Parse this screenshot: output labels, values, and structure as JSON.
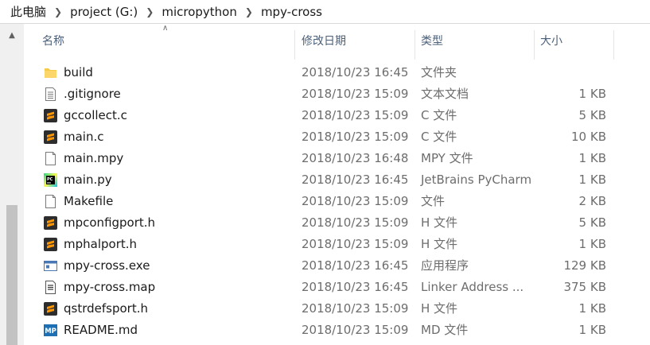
{
  "breadcrumb": [
    "此电脑",
    "project (G:)",
    "micropython",
    "mpy-cross"
  ],
  "columns": {
    "name": "名称",
    "date": "修改日期",
    "type": "类型",
    "size": "大小"
  },
  "files": [
    {
      "name": "build",
      "date": "2018/10/23 16:45",
      "type": "文件夹",
      "size": "",
      "icon": "folder-icon"
    },
    {
      "name": ".gitignore",
      "date": "2018/10/23 15:09",
      "type": "文本文档",
      "size": "1 KB",
      "icon": "text-document-icon"
    },
    {
      "name": "gccollect.c",
      "date": "2018/10/23 15:09",
      "type": "C 文件",
      "size": "5 KB",
      "icon": "sublime-file-icon"
    },
    {
      "name": "main.c",
      "date": "2018/10/23 15:09",
      "type": "C 文件",
      "size": "10 KB",
      "icon": "sublime-file-icon"
    },
    {
      "name": "main.mpy",
      "date": "2018/10/23 16:48",
      "type": "MPY 文件",
      "size": "1 KB",
      "icon": "blank-file-icon"
    },
    {
      "name": "main.py",
      "date": "2018/10/23 16:45",
      "type": "JetBrains PyCharm",
      "size": "1 KB",
      "icon": "pycharm-file-icon"
    },
    {
      "name": "Makefile",
      "date": "2018/10/23 15:09",
      "type": "文件",
      "size": "2 KB",
      "icon": "blank-file-icon"
    },
    {
      "name": "mpconfigport.h",
      "date": "2018/10/23 15:09",
      "type": "H 文件",
      "size": "5 KB",
      "icon": "sublime-file-icon"
    },
    {
      "name": "mphalport.h",
      "date": "2018/10/23 15:09",
      "type": "H 文件",
      "size": "1 KB",
      "icon": "sublime-file-icon"
    },
    {
      "name": "mpy-cross.exe",
      "date": "2018/10/23 16:45",
      "type": "应用程序",
      "size": "129 KB",
      "icon": "exe-icon"
    },
    {
      "name": "mpy-cross.map",
      "date": "2018/10/23 16:45",
      "type": "Linker Address ...",
      "size": "375 KB",
      "icon": "map-file-icon"
    },
    {
      "name": "qstrdefsport.h",
      "date": "2018/10/23 15:09",
      "type": "H 文件",
      "size": "1 KB",
      "icon": "sublime-file-icon"
    },
    {
      "name": "README.md",
      "date": "2018/10/23 15:09",
      "type": "MD 文件",
      "size": "1 KB",
      "icon": "markdown-file-icon"
    }
  ],
  "colors": {
    "sublime": "#e8732a",
    "folder": "#f7c948",
    "header_text": "#4c607a",
    "meta_text": "#6d6d6d"
  }
}
